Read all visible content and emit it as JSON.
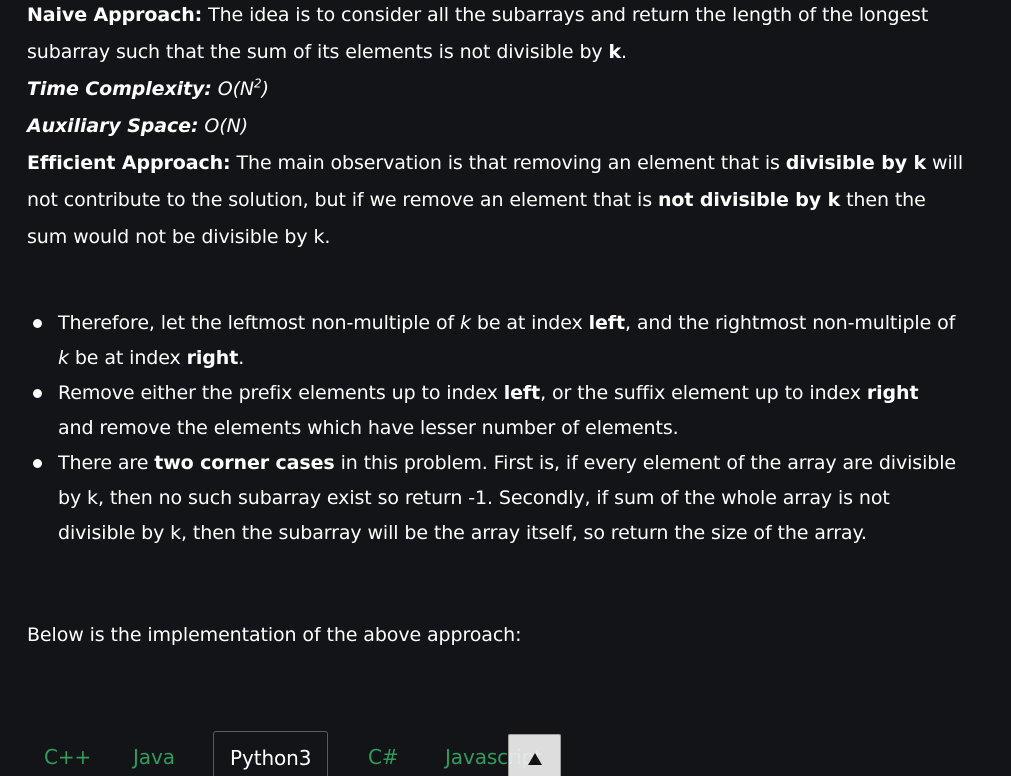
{
  "naive": {
    "label": "Naive Approach:",
    "text_1": " The idea is to consider all the subarrays and return the length of the longest subarray such that the sum of its elements is not divisible by ",
    "k": "k",
    "end": "."
  },
  "time_complexity": {
    "label": "Time Complexity:",
    "value_pre": " O(N",
    "value_sup": "2",
    "value_post": ")"
  },
  "aux_space": {
    "label": "Auxiliary Space:",
    "value": " O(N)"
  },
  "efficient": {
    "label": "Efficient Approach:",
    "text_1": " The main observation is that removing an element that is ",
    "bold_1": "divisible by k",
    "text_2": " will not contribute to the solution, but if we remove an element that is ",
    "bold_2": "not divisible by k",
    "text_3": " then the sum would not be divisible by k."
  },
  "bullets": [
    {
      "t1": "Therefore, let the leftmost non-multiple of ",
      "i1": "k",
      "t2": " be at index ",
      "b1": "left",
      "t3": ", and the rightmost non-multiple of ",
      "i2": "k",
      "t4": " be at index ",
      "b2": "right",
      "t5": "."
    },
    {
      "t1": "Remove either the prefix elements up to index ",
      "b1": "left",
      "t2": ", or the suffix element up to index ",
      "b2": "right",
      "t3": " and remove the elements which have lesser number of elements."
    },
    {
      "t1": "There are ",
      "b1": "two corner cases",
      "t2": " in this problem. First is, if every element of the array are divisible by k, then no such subarray exist so return -1. Secondly, if sum of the whole array is not divisible by k, then the subarray will be the array itself, so return the size of the array."
    }
  ],
  "below": "Below is the implementation of the above approach:",
  "tabs": [
    {
      "label": "C++"
    },
    {
      "label": "Java"
    },
    {
      "label": "Python3"
    },
    {
      "label": "C#"
    },
    {
      "label": "Javascript"
    }
  ],
  "active_tab": "Python3",
  "scroll_top_icon": "triangle-up",
  "colors": {
    "background": "#131417",
    "text": "#ffffff",
    "tab_text": "#2f9c5c"
  }
}
